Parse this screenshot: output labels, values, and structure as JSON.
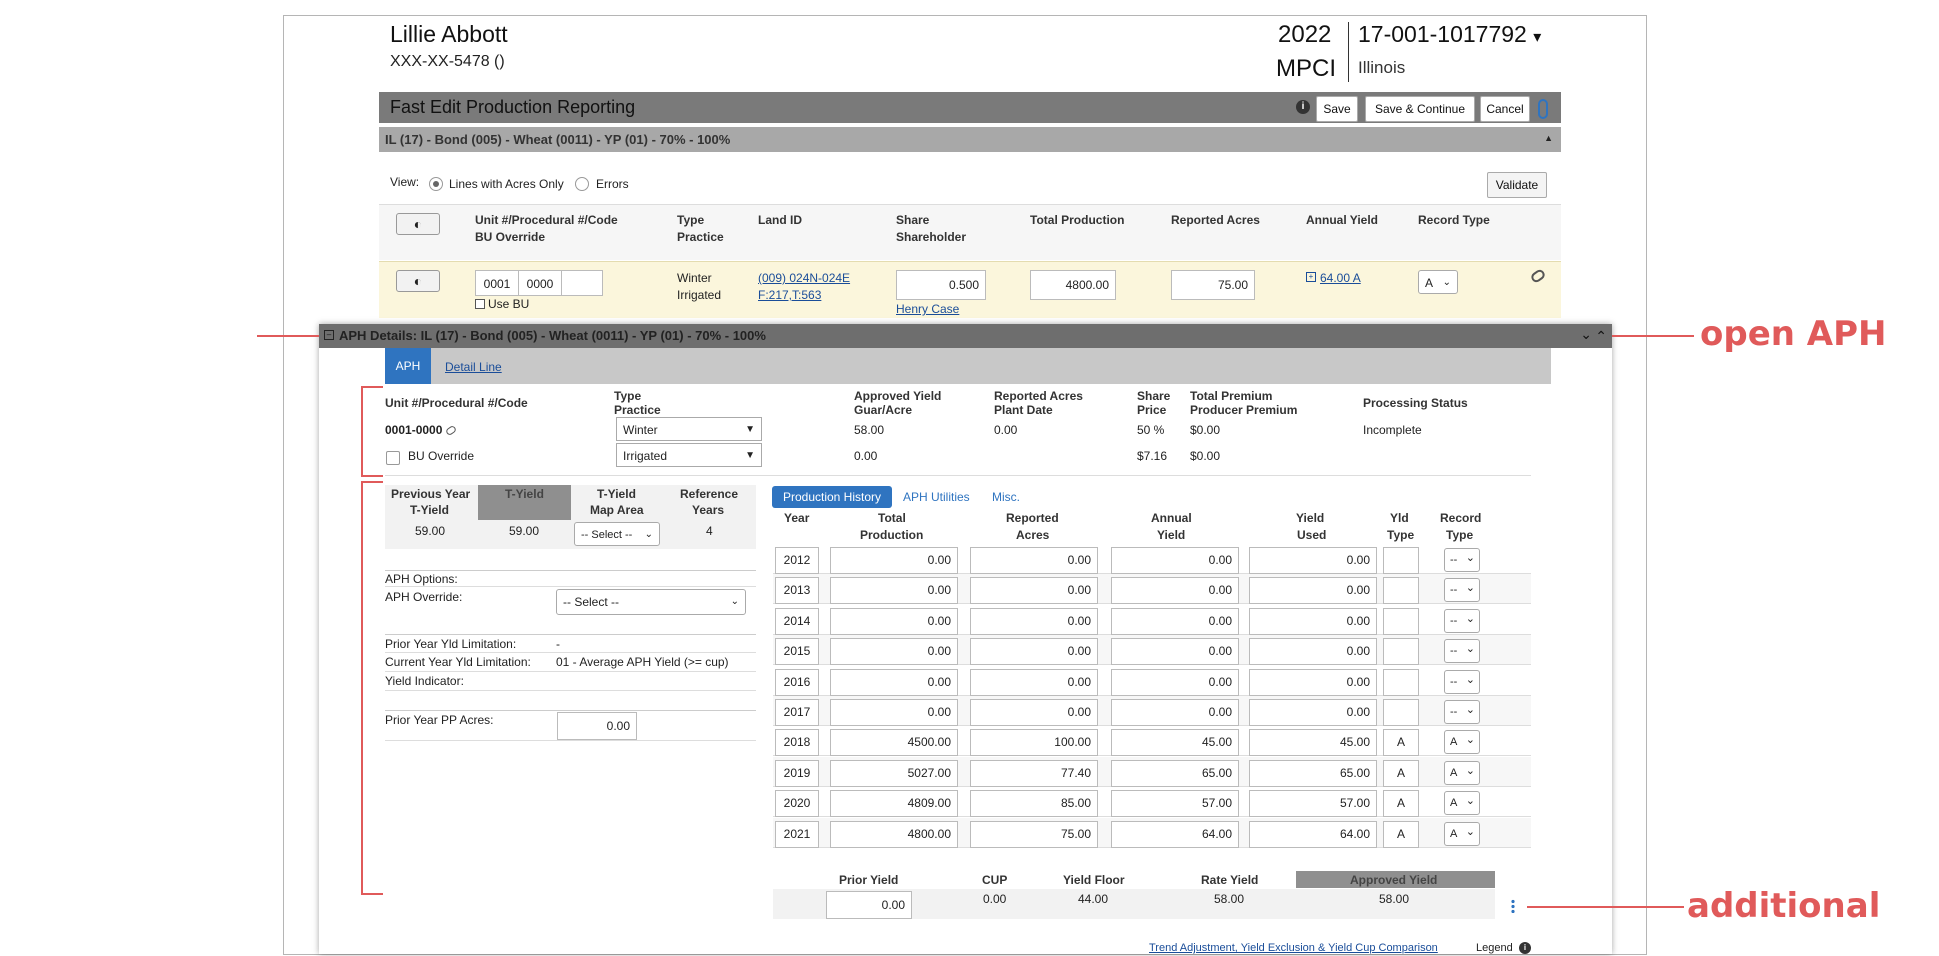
{
  "header": {
    "name": "Lillie Abbott",
    "ssn": "XXX-XX-5478 ()",
    "year": "2022",
    "program": "MPCI",
    "policy": "17-001-1017792",
    "policy_caret": "▾",
    "state": "Illinois"
  },
  "toolbar": {
    "title": "Fast Edit Production Reporting",
    "info": "i",
    "save": "Save",
    "save_continue": "Save & Continue",
    "cancel": "Cancel"
  },
  "unit_bar": {
    "label": "IL (17) - Bond (005) - Wheat (0011) - YP (01) - 70% - 100%",
    "caret": "▲"
  },
  "view": {
    "label": "View:",
    "opt1": "Lines with Acres Only",
    "opt2": "Errors",
    "validate": "Validate"
  },
  "table_headers": {
    "unit": "Unit #/Procedural #/Code",
    "bu": "BU Override",
    "type": "Type",
    "practice": "Practice",
    "land": "Land ID",
    "share": "Share",
    "shareholder": "Shareholder",
    "total_prod": "Total Production",
    "rep_acres": "Reported Acres",
    "annual_yield": "Annual Yield",
    "record_type": "Record Type"
  },
  "row": {
    "unit": "0001",
    "proc": "0000",
    "use_bu": "Use BU",
    "type": "Winter",
    "practice": "Irrigated",
    "land1": "(009) 024N-024E",
    "land2": "F:217,T:563",
    "share": "0.500",
    "shareholder": "Henry Case",
    "total_prod": "4800.00",
    "rep_acres": "75.00",
    "annual_yield": "64.00 A",
    "record_type": "A"
  },
  "aph_bar": {
    "label": "APH Details: IL (17) - Bond (005) - Wheat (0011) - YP (01) - 70% - 100%"
  },
  "aph_tabs": {
    "aph": "APH",
    "detail": "Detail Line"
  },
  "aph_summary": {
    "h_unit": "Unit #/Procedural #/Code",
    "h_type": "Type",
    "h_practice": "Practice",
    "h_appr": "Approved Yield",
    "h_guar": "Guar/Acre",
    "h_rep": "Reported Acres",
    "h_plant": "Plant Date",
    "h_share": "Share",
    "h_price": "Price",
    "h_tp": "Total Premium",
    "h_pp": "Producer Premium",
    "h_status": "Processing Status",
    "unit": "0001-0000",
    "bu": "BU Override",
    "type": "Winter",
    "practice": "Irrigated",
    "appr": "58.00",
    "guar": "0.00",
    "rep": "0.00",
    "share": "50 %",
    "price": "$7.16",
    "tp": "$0.00",
    "pp": "$0.00",
    "status": "Incomplete"
  },
  "tyield": {
    "h_prev": "Previous Year",
    "h_prev2": "T-Yield",
    "h_ty": "T-Yield",
    "h_map": "T-Yield",
    "h_map2": "Map Area",
    "h_ref": "Reference",
    "h_ref2": "Years",
    "prev": "59.00",
    "ty": "59.00",
    "map": "-- Select --",
    "ref": "4"
  },
  "options": {
    "aph_options": "APH Options:",
    "aph_override": "APH Override:",
    "aph_override_val": "-- Select --",
    "prior_lim": "Prior Year Yld Limitation:",
    "prior_lim_val": "-",
    "curr_lim": "Current Year Yld Limitation:",
    "curr_lim_val": "01 - Average APH Yield (>= cup)",
    "yld_ind": "Yield Indicator:",
    "pp_acres": "Prior Year PP Acres:",
    "pp_acres_val": "0.00"
  },
  "ph_tabs": {
    "history": "Production History",
    "utilities": "APH Utilities",
    "misc": "Misc."
  },
  "ph_headers": {
    "year": "Year",
    "total": "Total",
    "production": "Production",
    "reported": "Reported",
    "acres": "Acres",
    "annual": "Annual",
    "yield": "Yield",
    "yield2": "Yield",
    "used": "Used",
    "yld": "Yld",
    "type": "Type",
    "record": "Record",
    "rtype": "Type"
  },
  "ph_rows": [
    {
      "year": "2012",
      "prod": "0.00",
      "acres": "0.00",
      "annual": "0.00",
      "used": "0.00",
      "yt": "",
      "rt": "--"
    },
    {
      "year": "2013",
      "prod": "0.00",
      "acres": "0.00",
      "annual": "0.00",
      "used": "0.00",
      "yt": "",
      "rt": "--"
    },
    {
      "year": "2014",
      "prod": "0.00",
      "acres": "0.00",
      "annual": "0.00",
      "used": "0.00",
      "yt": "",
      "rt": "--"
    },
    {
      "year": "2015",
      "prod": "0.00",
      "acres": "0.00",
      "annual": "0.00",
      "used": "0.00",
      "yt": "",
      "rt": "--"
    },
    {
      "year": "2016",
      "prod": "0.00",
      "acres": "0.00",
      "annual": "0.00",
      "used": "0.00",
      "yt": "",
      "rt": "--"
    },
    {
      "year": "2017",
      "prod": "0.00",
      "acres": "0.00",
      "annual": "0.00",
      "used": "0.00",
      "yt": "",
      "rt": "--"
    },
    {
      "year": "2018",
      "prod": "4500.00",
      "acres": "100.00",
      "annual": "45.00",
      "used": "45.00",
      "yt": "A",
      "rt": "A"
    },
    {
      "year": "2019",
      "prod": "5027.00",
      "acres": "77.40",
      "annual": "65.00",
      "used": "65.00",
      "yt": "A",
      "rt": "A"
    },
    {
      "year": "2020",
      "prod": "4809.00",
      "acres": "85.00",
      "annual": "57.00",
      "used": "57.00",
      "yt": "A",
      "rt": "A"
    },
    {
      "year": "2021",
      "prod": "4800.00",
      "acres": "75.00",
      "annual": "64.00",
      "used": "64.00",
      "yt": "A",
      "rt": "A"
    }
  ],
  "summary": {
    "h_prior": "Prior Yield",
    "h_cup": "CUP",
    "h_floor": "Yield Floor",
    "h_rate": "Rate Yield",
    "h_appr": "Approved Yield",
    "prior": "0.00",
    "cup": "0.00",
    "floor": "44.00",
    "rate": "58.00",
    "appr": "58.00"
  },
  "footer": {
    "trend_link": "Trend Adjustment, Yield Exclusion & Yield Cup Comparison",
    "legend": "Legend"
  },
  "annotations": {
    "open_aph": "open APH",
    "additional": "additional"
  },
  "colors": {
    "accent": "#2f74c0",
    "annotation": "#e05a5a",
    "dark_bar": "#7a7a7a",
    "mid_bar": "#a8a8a8",
    "row_highlight": "#fbf6dc"
  }
}
